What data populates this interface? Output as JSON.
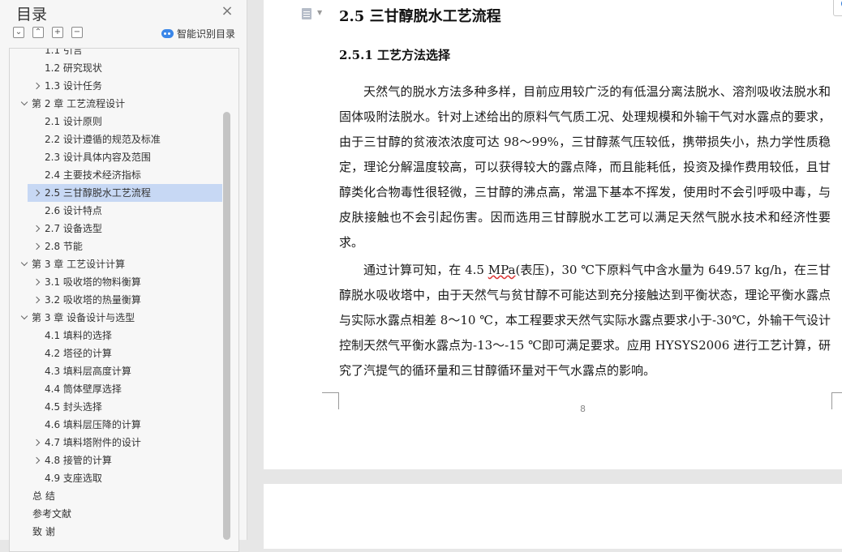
{
  "sidebar": {
    "title": "目录",
    "close_icon": "×",
    "tools": [
      {
        "name": "collapse-all-button",
        "glyph": "⌄"
      },
      {
        "name": "expand-all-button",
        "glyph": "⌃"
      },
      {
        "name": "add-heading-button",
        "glyph": "+"
      },
      {
        "name": "remove-heading-button",
        "glyph": "−"
      }
    ],
    "smart_toc_label": "智能识别目录",
    "items": [
      {
        "label": "1.1 引言",
        "level": 2,
        "chevron": "none"
      },
      {
        "label": "1.2 研究现状",
        "level": 2,
        "chevron": "none"
      },
      {
        "label": "1.3 设计任务",
        "level": 2,
        "chevron": "right"
      },
      {
        "label": "第 2 章  工艺流程设计",
        "level": 1,
        "chevron": "down"
      },
      {
        "label": "2.1  设计原则",
        "level": 2,
        "chevron": "none"
      },
      {
        "label": "2.2  设计遵循的规范及标准",
        "level": 2,
        "chevron": "none"
      },
      {
        "label": "2.3  设计具体内容及范围",
        "level": 2,
        "chevron": "none"
      },
      {
        "label": "2.4  主要技术经济指标",
        "level": 2,
        "chevron": "none"
      },
      {
        "label": "2.5  三甘醇脱水工艺流程",
        "level": 2,
        "chevron": "right",
        "selected": true
      },
      {
        "label": "2.6  设计特点",
        "level": 2,
        "chevron": "none"
      },
      {
        "label": "2.7 设备选型",
        "level": 2,
        "chevron": "right"
      },
      {
        "label": "2.8 节能",
        "level": 2,
        "chevron": "right"
      },
      {
        "label": "第 3 章  工艺设计计算",
        "level": 1,
        "chevron": "down"
      },
      {
        "label": "3.1 吸收塔的物料衡算",
        "level": 2,
        "chevron": "right"
      },
      {
        "label": "3.2 吸收塔的热量衡算",
        "level": 2,
        "chevron": "right"
      },
      {
        "label": "第 3 章  设备设计与选型",
        "level": 1,
        "chevron": "down"
      },
      {
        "label": "4.1 填料的选择",
        "level": 2,
        "chevron": "none"
      },
      {
        "label": "4.2  塔径的计算",
        "level": 2,
        "chevron": "none"
      },
      {
        "label": "4.3  填料层高度计算",
        "level": 2,
        "chevron": "none"
      },
      {
        "label": "4.4 筒体壁厚选择",
        "level": 2,
        "chevron": "none"
      },
      {
        "label": "4.5 封头选择",
        "level": 2,
        "chevron": "none"
      },
      {
        "label": "4.6 填料层压降的计算",
        "level": 2,
        "chevron": "none"
      },
      {
        "label": "4.7 填料塔附件的设计",
        "level": 2,
        "chevron": "right"
      },
      {
        "label": "4.8 接管的计算",
        "level": 2,
        "chevron": "right"
      },
      {
        "label": "4.9  支座选取",
        "level": 2,
        "chevron": "none"
      },
      {
        "label": "总    结",
        "level": 0,
        "chevron": "none"
      },
      {
        "label": "参考文献",
        "level": 0,
        "chevron": "none"
      },
      {
        "label": "致    谢",
        "level": 0,
        "chevron": "none"
      }
    ]
  },
  "document": {
    "section_heading": "2.5  三甘醇脱水工艺流程",
    "subsection_heading": "2.5.1 工艺方法选择",
    "paragraph1": "天然气的脱水方法多种多样，目前应用较广泛的有低温分离法脱水、溶剂吸收法脱水和固体吸附法脱水。针对上述给出的原料气气质工况、处理规模和外输干气对水露点的要求，由于三甘醇的贫液浓浓度可达 98～99%，三甘醇蒸气压较低，携带损失小，热力学性质稳定，理论分解温度较高，可以获得较大的露点降，而且能耗低，投资及操作费用较低，且甘醇类化合物毒性很轻微，三甘醇的沸点高，常温下基本不挥发，使用时不会引呼吸中毒，与皮肤接触也不会引起伤害。因而选用三甘醇脱水工艺可以满足天然气脱水技术和经济性要求。",
    "paragraph2_before": "通过计算可知，在 4.5 ",
    "paragraph2_spell": "MPa",
    "paragraph2_after": "(表压)，30 ℃下原料气中含水量为 649.57 kg/h，在三甘醇脱水吸收塔中，由于天然气与贫甘醇不可能达到充分接触达到平衡状态，理论平衡水露点与实际水露点相差 8～10 ℃，本工程要求天然气实际水露点要求小于-30℃，外输干气设计控制天然气平衡水露点为-13～-15 ℃即可满足要求。应用 HYSYS2006 进行工艺计算，研究了汽提气的循环量和三甘醇循环量对干气水露点的影响。",
    "page_number": "8"
  }
}
